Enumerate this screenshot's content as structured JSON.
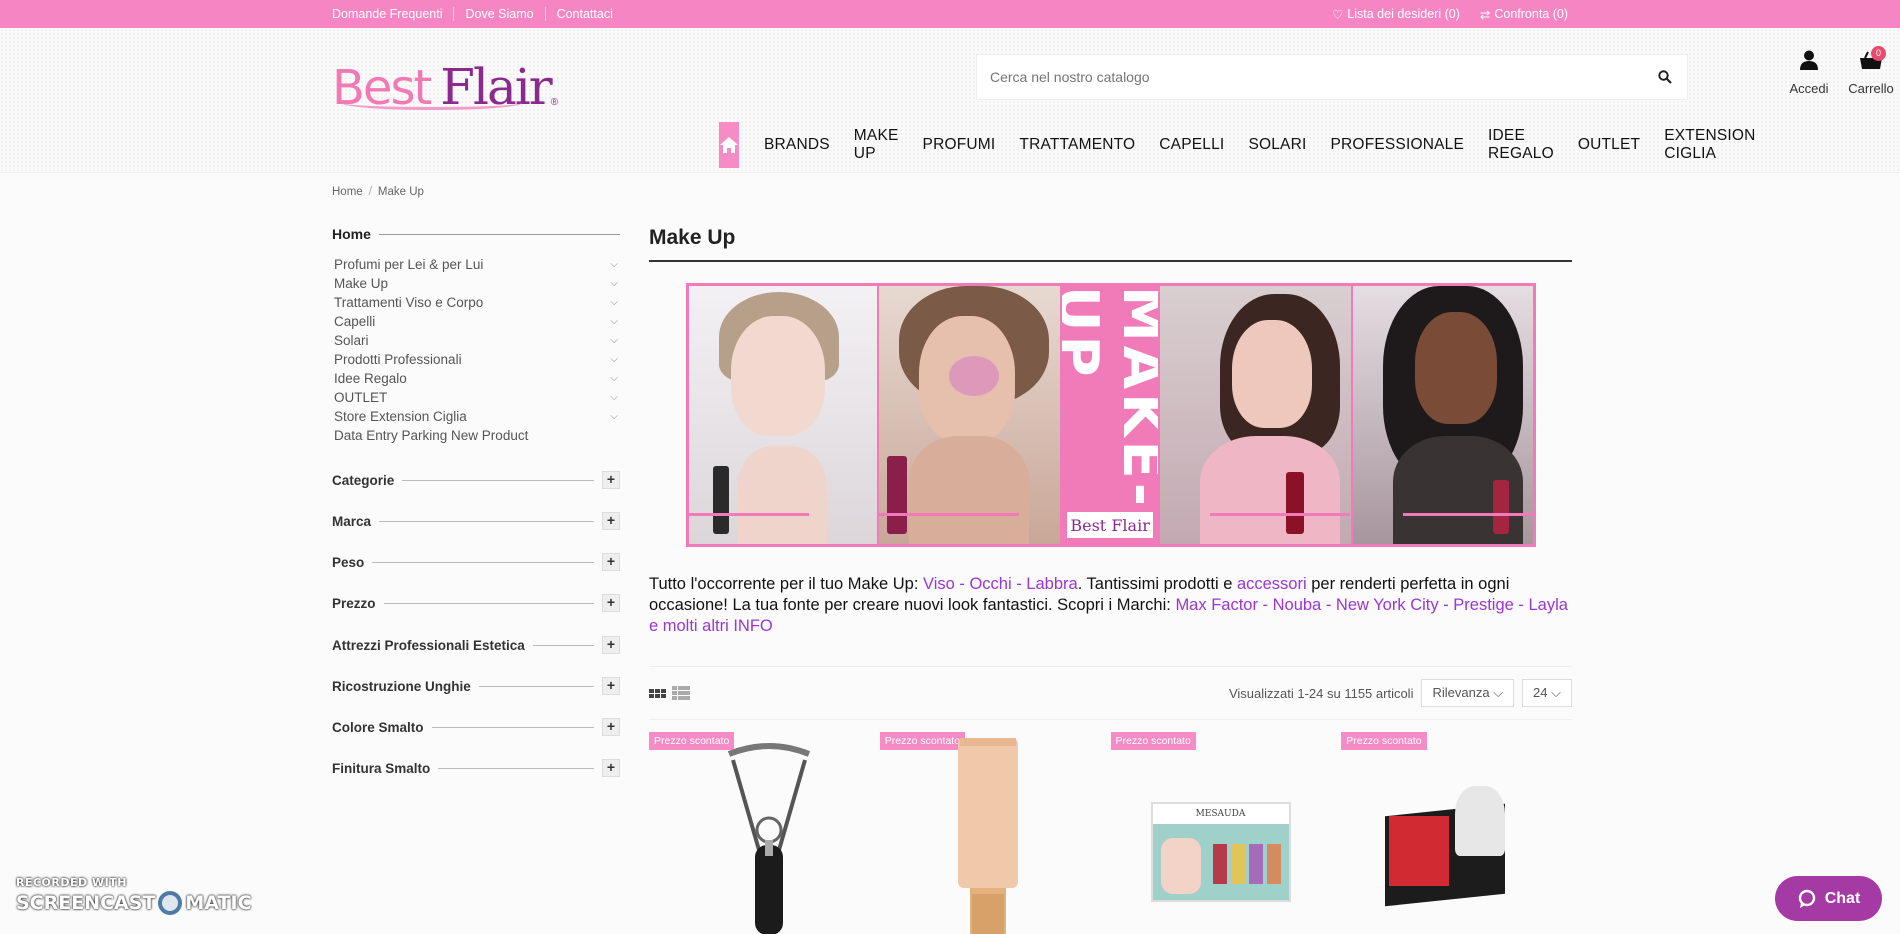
{
  "topbar": {
    "links": [
      "Domande Frequenti",
      "Dove Siamo",
      "Contattaci"
    ],
    "wishlist": "Lista dei desideri (0)",
    "compare": "Confronta (0)"
  },
  "header": {
    "logo_best": "Best",
    "logo_flair": "Flair",
    "search_placeholder": "Cerca nel nostro catalogo",
    "account_label": "Accedi",
    "cart_label": "Carrello",
    "cart_count": "0"
  },
  "nav": [
    "BRANDS",
    "MAKE UP",
    "PROFUMI",
    "TRATTAMENTO",
    "CAPELLI",
    "SOLARI",
    "PROFESSIONALE",
    "IDEE REGALO",
    "OUTLET",
    "EXTENSION CIGLIA"
  ],
  "breadcrumb": [
    "Home",
    "Make Up"
  ],
  "sidebar": {
    "home": "Home",
    "categories": [
      {
        "label": "Profumi per Lei & per Lui",
        "expandable": true
      },
      {
        "label": "Make Up",
        "expandable": true
      },
      {
        "label": "Trattamenti Viso e Corpo",
        "expandable": true
      },
      {
        "label": "Capelli",
        "expandable": true
      },
      {
        "label": "Solari",
        "expandable": true
      },
      {
        "label": "Prodotti Professionali",
        "expandable": true
      },
      {
        "label": "Idee Regalo",
        "expandable": true
      },
      {
        "label": "OUTLET",
        "expandable": true
      },
      {
        "label": "Store Extension Ciglia",
        "expandable": true
      },
      {
        "label": "Data Entry Parking New Product",
        "expandable": false
      }
    ],
    "facets": [
      "Categorie",
      "Marca",
      "Peso",
      "Prezzo",
      "Attrezzi Professionali Estetica",
      "Ricostruzione Unghie",
      "Colore Smalto",
      "Finitura Smalto"
    ]
  },
  "main": {
    "title": "Make Up",
    "banner_text": "MAKE-UP",
    "banner_logo": "Best Flair",
    "desc": {
      "p1": "Tutto l'occorrente per il tuo Make Up: ",
      "l1": "Viso - Occhi - Labbra",
      "p2": ". Tantissimi prodotti e ",
      "l2": "accessori",
      "p3": " per renderti perfetta in ogni occasione! La tua fonte per creare nuovi look fantastici. Scopri i Marchi: ",
      "l3": "Max Factor - Nouba - New York City - Prestige - Layla e molti altri INFO"
    },
    "count_text": "Visualizzati 1-24 su 1155 articoli",
    "sort_label": "Rilevanza",
    "per_page": "24",
    "products": [
      {
        "flag": "Prezzo scontato"
      },
      {
        "flag": "Prezzo scontato"
      },
      {
        "flag": "Prezzo scontato",
        "brand_on_box": "MESAUDA"
      },
      {
        "flag": "Prezzo scontato"
      }
    ]
  },
  "overlays": {
    "recorded": "RECORDED WITH",
    "screencast_a": "SCREENCAST",
    "screencast_b": "MATIC",
    "chat": "Chat"
  },
  "colors": {
    "brand_pink": "#f585c3",
    "link_purple": "#9c35d6",
    "chat_purple": "#a53aa5"
  }
}
